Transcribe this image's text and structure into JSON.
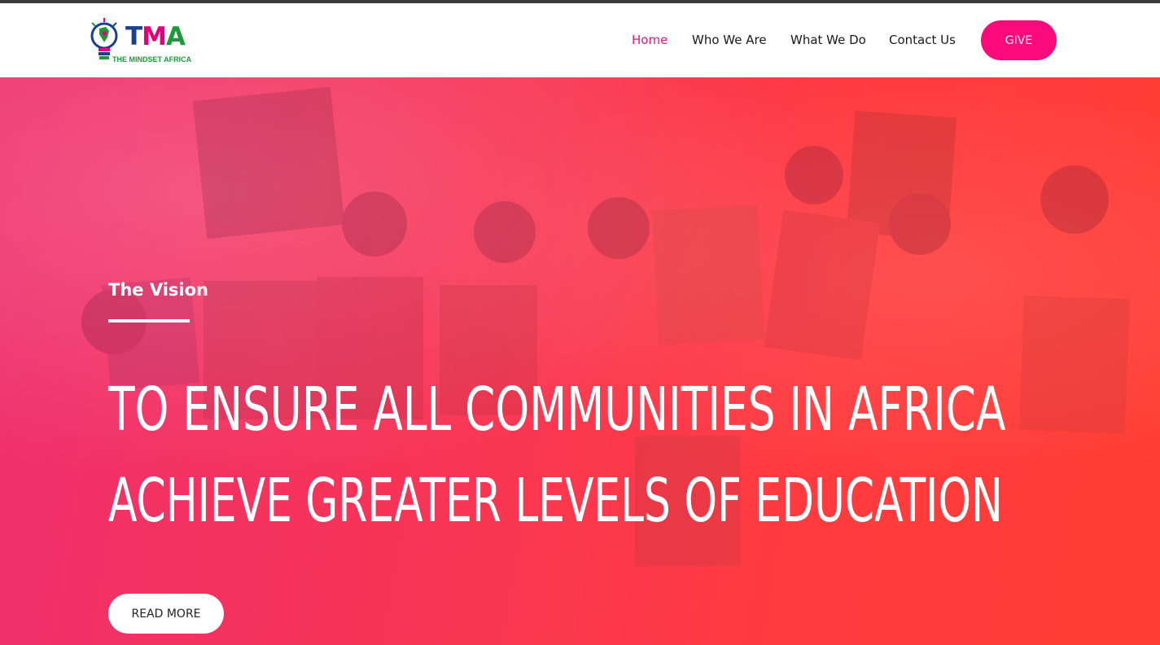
{
  "brand": {
    "logo_letters": {
      "t": "T",
      "m": "M",
      "a": "A"
    },
    "logo_subtitle": "THE MINDSET AFRICA",
    "colors": {
      "blue": "#1b3f8f",
      "magenta": "#e4007c",
      "green": "#1e9a3a"
    }
  },
  "nav": {
    "items": [
      {
        "label": "Home",
        "active": true
      },
      {
        "label": "Who We Are",
        "active": false
      },
      {
        "label": "What We Do",
        "active": false
      },
      {
        "label": "Contact Us",
        "active": false
      }
    ],
    "give_label": "GIVE"
  },
  "hero": {
    "kicker": "The Vision",
    "headline_lines": [
      "TO ENSURE ALL COMMUNITIES IN AFRICA",
      "ACHIEVE GREATER LEVELS OF EDUCATION"
    ],
    "cta_label": "READ MORE"
  },
  "colors": {
    "accent": "#fb0a7b",
    "active_nav": "#e6197b",
    "hero_overlay_start": "#ee2f6e",
    "hero_overlay_end": "#ff3d33"
  }
}
